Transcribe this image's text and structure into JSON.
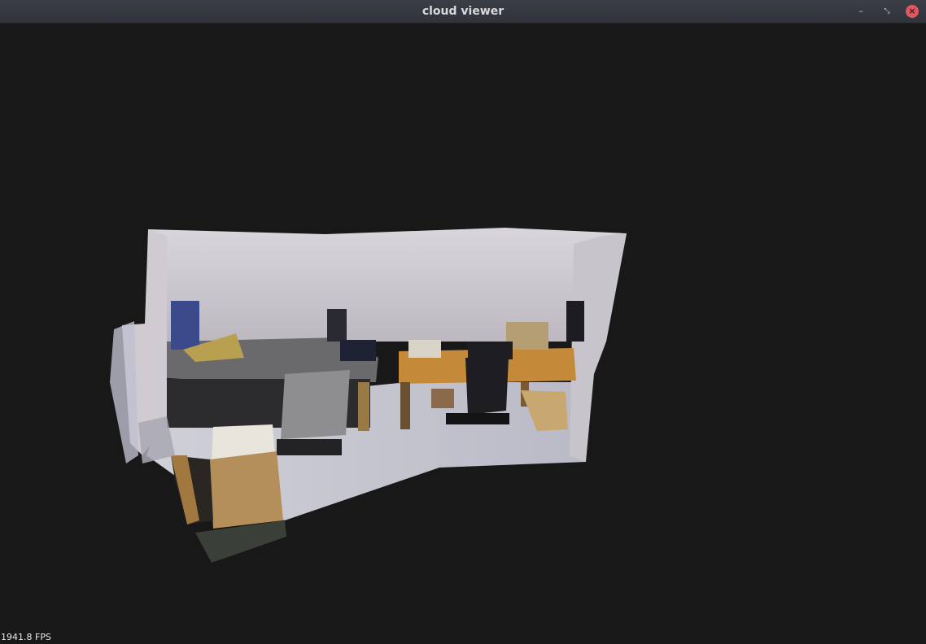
{
  "window": {
    "title": "cloud viewer",
    "controls": [
      "minimize-icon",
      "maximize-icon",
      "close-icon"
    ],
    "close_color": "#e0585f"
  },
  "viewer": {
    "background": "#181818",
    "fps_text": "1941.8 FPS"
  }
}
